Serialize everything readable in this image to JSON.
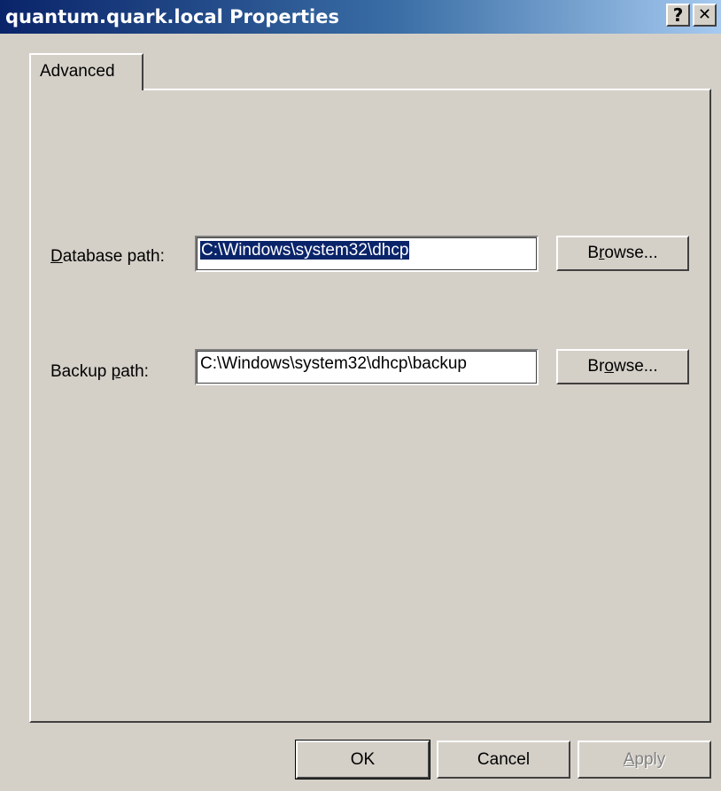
{
  "window": {
    "title": "quantum.quark.local Properties",
    "help_label": "?",
    "close_label": "✕"
  },
  "tabs": [
    {
      "label": "Advanced",
      "selected": true
    }
  ],
  "database": {
    "label_prefix": "",
    "label_mnemonic": "D",
    "label_rest": "atabase path:",
    "value": "C:\\Windows\\system32\\dhcp",
    "browse_pre": "B",
    "browse_mnemonic": "r",
    "browse_post": "owse..."
  },
  "backup": {
    "label_prefix": "Backup ",
    "label_mnemonic": "p",
    "label_rest": "ath:",
    "value": "C:\\Windows\\system32\\dhcp\\backup",
    "browse_pre": "Br",
    "browse_mnemonic": "o",
    "browse_post": "wse..."
  },
  "buttons": {
    "ok": "OK",
    "cancel": "Cancel",
    "apply_mnemonic": "A",
    "apply_rest": "pply"
  },
  "colors": {
    "face": "#d4d0c8",
    "title_start": "#0a246a",
    "title_end": "#a6caf0",
    "selection": "#0a246a"
  }
}
